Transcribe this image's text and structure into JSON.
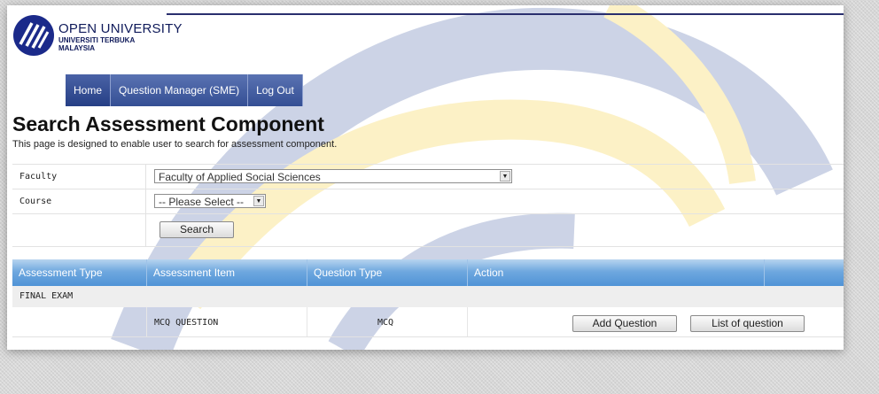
{
  "brand": {
    "name": "OPEN UNIVERSITY",
    "line2": "UNIVERSITI TERBUKA",
    "line3": "MALAYSIA"
  },
  "nav": {
    "items": [
      {
        "label": "Home"
      },
      {
        "label": "Question Manager (SME)"
      },
      {
        "label": "Log Out"
      }
    ]
  },
  "page": {
    "title": "Search Assessment Component",
    "description": "This page is designed to enable user to search for assessment component."
  },
  "form": {
    "faculty_label": "Faculty",
    "faculty_value": "Faculty of Applied Social Sciences",
    "course_label": "Course",
    "course_value": "-- Please Select --",
    "search_label": "Search"
  },
  "table": {
    "headers": [
      "Assessment Type",
      "Assessment Item",
      "Question Type",
      "Action"
    ],
    "group": "FINAL EXAM",
    "rows": [
      {
        "item": "MCQ QUESTION",
        "question_type": "MCQ",
        "add_label": "Add Question",
        "list_label": "List of question"
      }
    ]
  },
  "colors": {
    "nav": "#344f94",
    "table_header": "#4f93d6",
    "watermark_blue": "#1b3d8f",
    "watermark_yellow": "#f2c200"
  }
}
